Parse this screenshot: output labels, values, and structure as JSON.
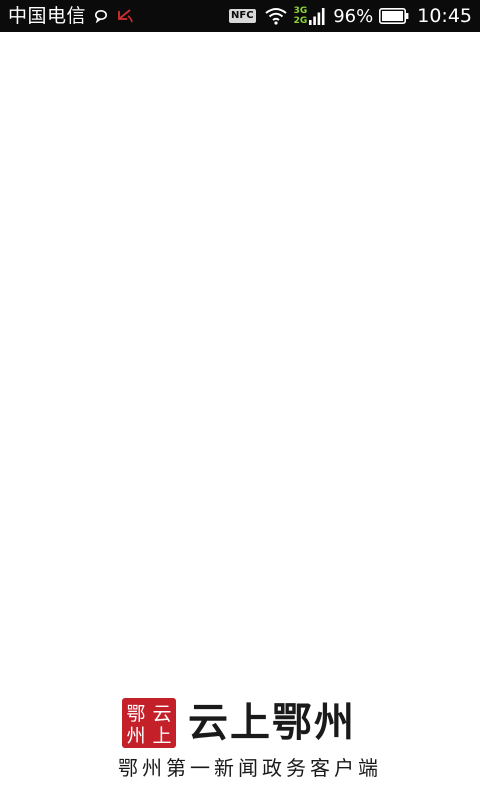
{
  "status_bar": {
    "carrier": "中国电信",
    "icons": [
      "message-icon",
      "missed-call-icon",
      "nfc-icon",
      "wifi-icon",
      "signal-icon",
      "battery-icon"
    ],
    "nfc_label": "NFC",
    "network_top": "3G",
    "network_bottom": "2G",
    "battery_percent": "96%",
    "time": "10:45",
    "colors": {
      "background": "#0b0b0b",
      "missed_call": "#d32f2f",
      "network": "#8ed33a"
    }
  },
  "splash": {
    "logo_seal": [
      "鄂",
      "州",
      "云",
      "上"
    ],
    "app_name": "云上鄂州",
    "slogan": "鄂州第一新闻政务客户端",
    "colors": {
      "seal": "#c4202a",
      "text": "#1a1a1a",
      "background": "#ffffff"
    }
  }
}
